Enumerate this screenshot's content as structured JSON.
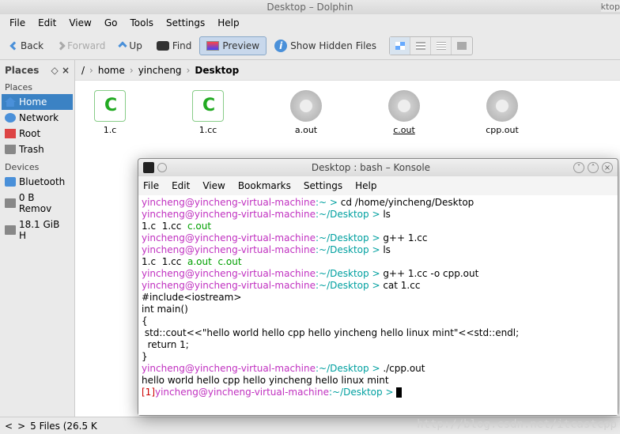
{
  "window_title": "Desktop – Dolphin",
  "truncated_label": "ktop",
  "menubar": [
    "File",
    "Edit",
    "View",
    "Go",
    "Tools",
    "Settings",
    "Help"
  ],
  "toolbar": {
    "back": "Back",
    "forward": "Forward",
    "up": "Up",
    "find": "Find",
    "preview": "Preview",
    "show_hidden": "Show Hidden Files"
  },
  "sidebar": {
    "header": "Places",
    "places_title": "Places",
    "devices_title": "Devices",
    "places": [
      {
        "label": "Home",
        "icon": "home-ic",
        "sel": true
      },
      {
        "label": "Network",
        "icon": "net-ic"
      },
      {
        "label": "Root",
        "icon": "root-ic"
      },
      {
        "label": "Trash",
        "icon": "trash-ic"
      }
    ],
    "devices": [
      {
        "label": "Bluetooth",
        "icon": "bt-ic"
      },
      {
        "label": "0 B Remov",
        "icon": "disk-ic"
      },
      {
        "label": "18.1 GiB H",
        "icon": "disk-ic"
      }
    ]
  },
  "breadcrumb": [
    "/",
    "home",
    "yincheng",
    "Desktop"
  ],
  "files": [
    {
      "name": "1.c",
      "type": "c"
    },
    {
      "name": "1.cc",
      "type": "c"
    },
    {
      "name": "a.out",
      "type": "gear"
    },
    {
      "name": "c.out",
      "type": "gear",
      "sel": true
    },
    {
      "name": "cpp.out",
      "type": "gear"
    }
  ],
  "status": "5 Files (26.5 K",
  "konsole": {
    "title": "Desktop : bash – Konsole",
    "menubar": [
      "File",
      "Edit",
      "View",
      "Bookmarks",
      "Settings",
      "Help"
    ],
    "lines": [
      {
        "prompt": "yincheng@yincheng-virtual-machine",
        "path": ":~",
        "sep": " > ",
        "cmd": "cd /home/yincheng/Desktop"
      },
      {
        "prompt": "yincheng@yincheng-virtual-machine",
        "path": ":~/Desktop",
        "sep": " > ",
        "cmd": "ls"
      },
      {
        "ls": [
          "1.c",
          "1.cc",
          "c.out"
        ]
      },
      {
        "prompt": "yincheng@yincheng-virtual-machine",
        "path": ":~/Desktop",
        "sep": " > ",
        "cmd": "g++ 1.cc"
      },
      {
        "prompt": "yincheng@yincheng-virtual-machine",
        "path": ":~/Desktop",
        "sep": " > ",
        "cmd": "ls"
      },
      {
        "ls": [
          "1.c",
          "1.cc",
          "a.out",
          "c.out"
        ]
      },
      {
        "prompt": "yincheng@yincheng-virtual-machine",
        "path": ":~/Desktop",
        "sep": " > ",
        "cmd": "g++ 1.cc -o cpp.out"
      },
      {
        "prompt": "yincheng@yincheng-virtual-machine",
        "path": ":~/Desktop",
        "sep": " > ",
        "cmd": "cat 1.cc"
      },
      {
        "plain": "#include<iostream>"
      },
      {
        "plain": ""
      },
      {
        "plain": "int main()"
      },
      {
        "plain": "{"
      },
      {
        "plain": " std::cout<<\"hello world hello cpp hello yincheng hello linux mint\"<<std::endl;"
      },
      {
        "plain": "  return 1;"
      },
      {
        "plain": "}"
      },
      {
        "prompt": "yincheng@yincheng-virtual-machine",
        "path": ":~/Desktop",
        "sep": " > ",
        "cmd": "./cpp.out"
      },
      {
        "plain": "hello world hello cpp hello yincheng hello linux mint"
      },
      {
        "job": "[1]",
        "prompt": "yincheng@yincheng-virtual-machine",
        "path": ":~/Desktop",
        "sep": " > ",
        "cursor": true
      }
    ]
  },
  "watermark": "http://blog.csdn.net/itcastcpp"
}
